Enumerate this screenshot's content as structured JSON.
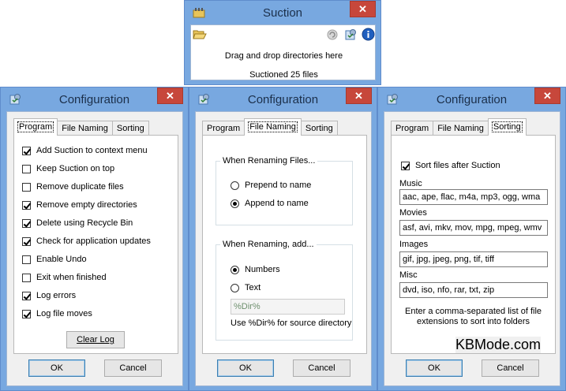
{
  "suction": {
    "title": "Suction",
    "drop_text": "Drag and drop directories here",
    "status_text": "Suctioned 25 files",
    "close": "✕"
  },
  "config": {
    "title": "Configuration",
    "close": "✕",
    "tabs": {
      "program": "Program",
      "file_naming": "File Naming",
      "sorting": "Sorting"
    },
    "ok": "OK",
    "cancel": "Cancel"
  },
  "program": {
    "options": [
      {
        "label": "Add Suction to context menu",
        "checked": true
      },
      {
        "label": "Keep Suction on top",
        "checked": false
      },
      {
        "label": "Remove duplicate files",
        "checked": false
      },
      {
        "label": "Remove empty directories",
        "checked": true
      },
      {
        "label": "Delete using Recycle Bin",
        "checked": true
      },
      {
        "label": "Check for application updates",
        "checked": true
      },
      {
        "label": "Enable Undo",
        "checked": false
      },
      {
        "label": "Exit when finished",
        "checked": false
      },
      {
        "label": "Log errors",
        "checked": true
      },
      {
        "label": "Log file moves",
        "checked": true
      }
    ],
    "clear_log": "Clear Log"
  },
  "file_naming": {
    "renaming_group": "When Renaming Files...",
    "prepend": "Prepend to name",
    "append": "Append to name",
    "add_group": "When Renaming, add...",
    "numbers": "Numbers",
    "text": "Text",
    "text_value": "%Dir%",
    "hint": "Use %Dir% for source directory"
  },
  "sorting": {
    "sort_after": "Sort files after Suction",
    "music_label": "Music",
    "music_value": "aac, ape, flac, m4a, mp3, ogg, wma",
    "movies_label": "Movies",
    "movies_value": "asf, avi, mkv, mov, mpg, mpeg, wmv",
    "images_label": "Images",
    "images_value": "gif, jpg, jpeg, png, tif, tiff",
    "misc_label": "Misc",
    "misc_value": "dvd, iso, nfo, rar, txt, zip",
    "hint_line1": "Enter a comma-separated list of file",
    "hint_line2": "extensions to sort into folders"
  },
  "watermark": "KBMode.com",
  "colors": {
    "frame": "#78a8e0",
    "close": "#c7473b",
    "default_button": "#3c7fb1"
  }
}
